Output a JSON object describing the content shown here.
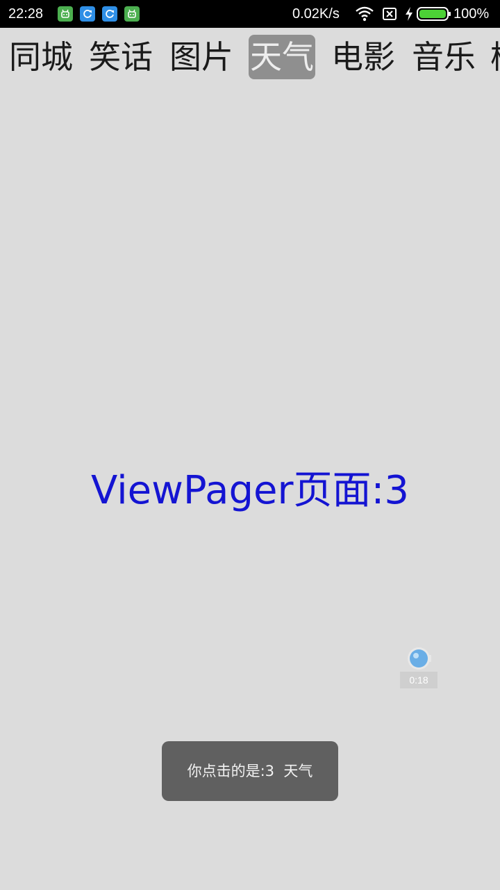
{
  "status_bar": {
    "time": "22:28",
    "notification_icons": [
      "android-icon",
      "sync-icon",
      "sync-icon",
      "android-icon"
    ],
    "net_speed": "0.02K/s",
    "battery": "100%",
    "icons": [
      "wifi-icon",
      "no-sim-icon",
      "charging-icon",
      "battery-icon"
    ]
  },
  "tabs": [
    {
      "label": "同城",
      "selected": false
    },
    {
      "label": "笑话",
      "selected": false
    },
    {
      "label": "图片",
      "selected": false
    },
    {
      "label": "天气",
      "selected": true
    },
    {
      "label": "电影",
      "selected": false
    },
    {
      "label": "音乐",
      "selected": false
    },
    {
      "label": "模",
      "selected": false
    }
  ],
  "page": {
    "label": "ViewPager页面:3"
  },
  "recorder": {
    "time": "0:18"
  },
  "toast": {
    "message": "你点击的是:3  天气"
  },
  "colors": {
    "background": "#dcdcdc",
    "page_text": "#1414d2",
    "selected_tab_bg": "#8f8f8f",
    "toast_bg": "#606060"
  }
}
